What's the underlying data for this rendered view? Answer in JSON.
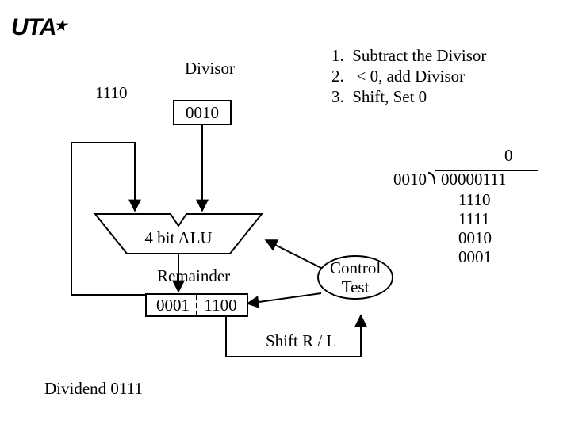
{
  "logo": "UTA",
  "divisor_label": "Divisor",
  "divisor_prev": "1110",
  "divisor_box": "0010",
  "alu_label": "4 bit ALU",
  "remainder_label": "Remainder",
  "remainder_hi": "0001",
  "remainder_lo": "1100",
  "control_label": "Control\nTest",
  "shift_label": "Shift R / L",
  "dividend_label": "Dividend 0111",
  "steps": {
    "s1": "1.  Subtract the Divisor",
    "s2": "2.   < 0, add Divisor",
    "s3": "3.  Shift, Set 0"
  },
  "long_division": {
    "quotient_bit": "0",
    "divisor": "0010",
    "dividend": "00000111",
    "l1": "1110",
    "l2": "1111",
    "l3": "0010",
    "l4": "0001"
  }
}
